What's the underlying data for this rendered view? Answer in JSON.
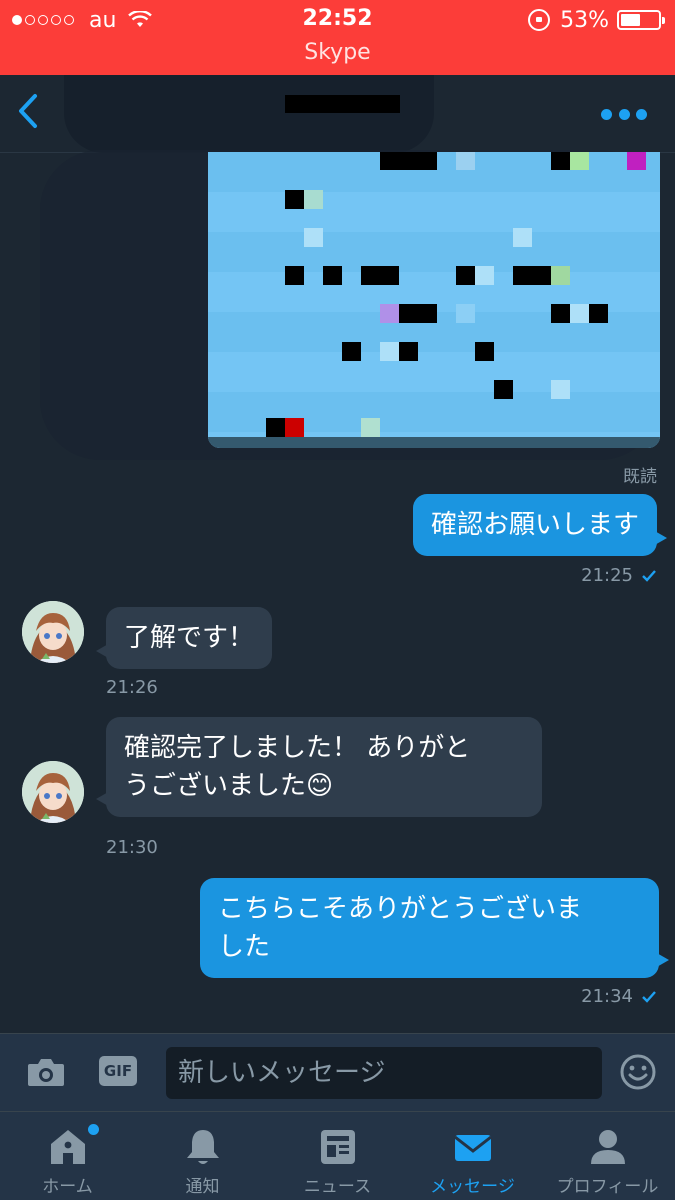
{
  "status_bar": {
    "carrier": "au",
    "time": "22:52",
    "app_name": "Skype",
    "battery": "53%",
    "battery_level": 0.53,
    "signal_dots_filled": 1,
    "bg_color": "#fc3d39"
  },
  "header": {
    "back_icon": "chevron-left-icon",
    "more_icon": "more-dots-icon",
    "accent_color": "#1da1f2"
  },
  "chat": {
    "read_label": "既読",
    "messages": [
      {
        "direction": "out",
        "text": "確認お願いします",
        "time": "21:25",
        "status_icon": "check-icon"
      },
      {
        "direction": "in",
        "text": "了解です！",
        "time": "21:26"
      },
      {
        "direction": "in",
        "text_line1": "確認完了しました！ ありがと",
        "text_line2": "うございました",
        "emoji": "😊",
        "time": "21:30"
      },
      {
        "direction": "out",
        "text_line1": "こちらこそありがとうございま",
        "text_line2": "した",
        "time": "21:34",
        "status_icon": "check-icon"
      }
    ]
  },
  "composer": {
    "camera_icon": "camera-icon",
    "gif_label": "GIF",
    "placeholder": "新しいメッセージ",
    "emoji_icon": "smiley-icon"
  },
  "tabs": [
    {
      "label": "ホーム",
      "icon": "home-icon",
      "badge": true
    },
    {
      "label": "通知",
      "icon": "bell-icon"
    },
    {
      "label": "ニュース",
      "icon": "news-icon"
    },
    {
      "label": "メッセージ",
      "icon": "envelope-icon",
      "active": true
    },
    {
      "label": "プロフィール",
      "icon": "profile-icon"
    }
  ]
}
